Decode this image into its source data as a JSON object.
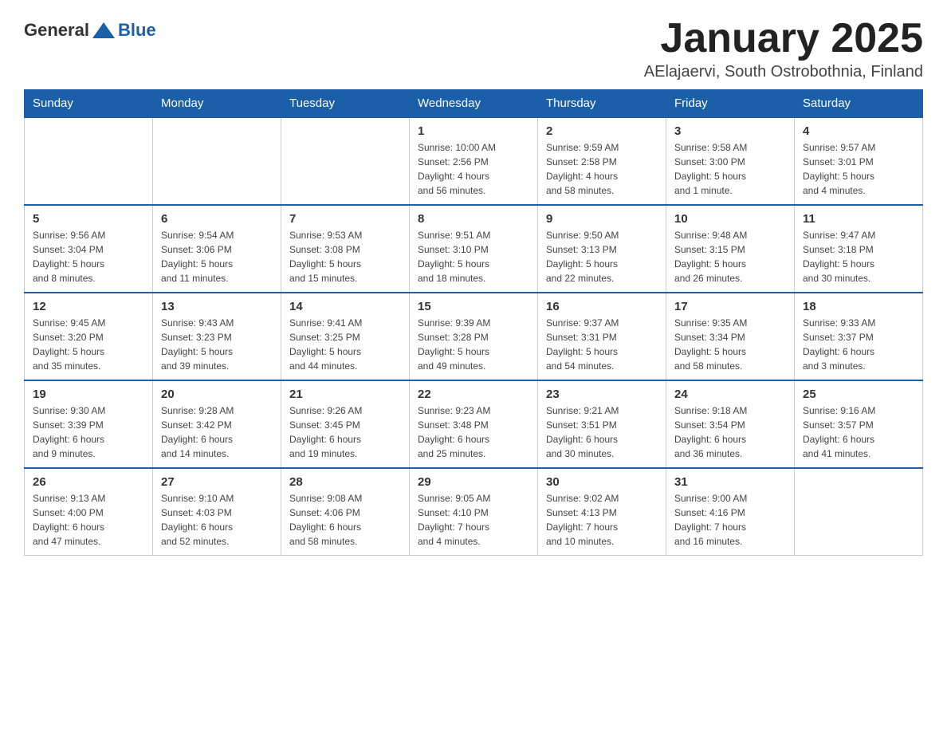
{
  "header": {
    "logo_general": "General",
    "logo_blue": "Blue",
    "month_title": "January 2025",
    "subtitle": "AElajaervi, South Ostrobothnia, Finland"
  },
  "weekdays": [
    "Sunday",
    "Monday",
    "Tuesday",
    "Wednesday",
    "Thursday",
    "Friday",
    "Saturday"
  ],
  "weeks": [
    [
      {
        "day": "",
        "info": ""
      },
      {
        "day": "",
        "info": ""
      },
      {
        "day": "",
        "info": ""
      },
      {
        "day": "1",
        "info": "Sunrise: 10:00 AM\nSunset: 2:56 PM\nDaylight: 4 hours\nand 56 minutes."
      },
      {
        "day": "2",
        "info": "Sunrise: 9:59 AM\nSunset: 2:58 PM\nDaylight: 4 hours\nand 58 minutes."
      },
      {
        "day": "3",
        "info": "Sunrise: 9:58 AM\nSunset: 3:00 PM\nDaylight: 5 hours\nand 1 minute."
      },
      {
        "day": "4",
        "info": "Sunrise: 9:57 AM\nSunset: 3:01 PM\nDaylight: 5 hours\nand 4 minutes."
      }
    ],
    [
      {
        "day": "5",
        "info": "Sunrise: 9:56 AM\nSunset: 3:04 PM\nDaylight: 5 hours\nand 8 minutes."
      },
      {
        "day": "6",
        "info": "Sunrise: 9:54 AM\nSunset: 3:06 PM\nDaylight: 5 hours\nand 11 minutes."
      },
      {
        "day": "7",
        "info": "Sunrise: 9:53 AM\nSunset: 3:08 PM\nDaylight: 5 hours\nand 15 minutes."
      },
      {
        "day": "8",
        "info": "Sunrise: 9:51 AM\nSunset: 3:10 PM\nDaylight: 5 hours\nand 18 minutes."
      },
      {
        "day": "9",
        "info": "Sunrise: 9:50 AM\nSunset: 3:13 PM\nDaylight: 5 hours\nand 22 minutes."
      },
      {
        "day": "10",
        "info": "Sunrise: 9:48 AM\nSunset: 3:15 PM\nDaylight: 5 hours\nand 26 minutes."
      },
      {
        "day": "11",
        "info": "Sunrise: 9:47 AM\nSunset: 3:18 PM\nDaylight: 5 hours\nand 30 minutes."
      }
    ],
    [
      {
        "day": "12",
        "info": "Sunrise: 9:45 AM\nSunset: 3:20 PM\nDaylight: 5 hours\nand 35 minutes."
      },
      {
        "day": "13",
        "info": "Sunrise: 9:43 AM\nSunset: 3:23 PM\nDaylight: 5 hours\nand 39 minutes."
      },
      {
        "day": "14",
        "info": "Sunrise: 9:41 AM\nSunset: 3:25 PM\nDaylight: 5 hours\nand 44 minutes."
      },
      {
        "day": "15",
        "info": "Sunrise: 9:39 AM\nSunset: 3:28 PM\nDaylight: 5 hours\nand 49 minutes."
      },
      {
        "day": "16",
        "info": "Sunrise: 9:37 AM\nSunset: 3:31 PM\nDaylight: 5 hours\nand 54 minutes."
      },
      {
        "day": "17",
        "info": "Sunrise: 9:35 AM\nSunset: 3:34 PM\nDaylight: 5 hours\nand 58 minutes."
      },
      {
        "day": "18",
        "info": "Sunrise: 9:33 AM\nSunset: 3:37 PM\nDaylight: 6 hours\nand 3 minutes."
      }
    ],
    [
      {
        "day": "19",
        "info": "Sunrise: 9:30 AM\nSunset: 3:39 PM\nDaylight: 6 hours\nand 9 minutes."
      },
      {
        "day": "20",
        "info": "Sunrise: 9:28 AM\nSunset: 3:42 PM\nDaylight: 6 hours\nand 14 minutes."
      },
      {
        "day": "21",
        "info": "Sunrise: 9:26 AM\nSunset: 3:45 PM\nDaylight: 6 hours\nand 19 minutes."
      },
      {
        "day": "22",
        "info": "Sunrise: 9:23 AM\nSunset: 3:48 PM\nDaylight: 6 hours\nand 25 minutes."
      },
      {
        "day": "23",
        "info": "Sunrise: 9:21 AM\nSunset: 3:51 PM\nDaylight: 6 hours\nand 30 minutes."
      },
      {
        "day": "24",
        "info": "Sunrise: 9:18 AM\nSunset: 3:54 PM\nDaylight: 6 hours\nand 36 minutes."
      },
      {
        "day": "25",
        "info": "Sunrise: 9:16 AM\nSunset: 3:57 PM\nDaylight: 6 hours\nand 41 minutes."
      }
    ],
    [
      {
        "day": "26",
        "info": "Sunrise: 9:13 AM\nSunset: 4:00 PM\nDaylight: 6 hours\nand 47 minutes."
      },
      {
        "day": "27",
        "info": "Sunrise: 9:10 AM\nSunset: 4:03 PM\nDaylight: 6 hours\nand 52 minutes."
      },
      {
        "day": "28",
        "info": "Sunrise: 9:08 AM\nSunset: 4:06 PM\nDaylight: 6 hours\nand 58 minutes."
      },
      {
        "day": "29",
        "info": "Sunrise: 9:05 AM\nSunset: 4:10 PM\nDaylight: 7 hours\nand 4 minutes."
      },
      {
        "day": "30",
        "info": "Sunrise: 9:02 AM\nSunset: 4:13 PM\nDaylight: 7 hours\nand 10 minutes."
      },
      {
        "day": "31",
        "info": "Sunrise: 9:00 AM\nSunset: 4:16 PM\nDaylight: 7 hours\nand 16 minutes."
      },
      {
        "day": "",
        "info": ""
      }
    ]
  ]
}
